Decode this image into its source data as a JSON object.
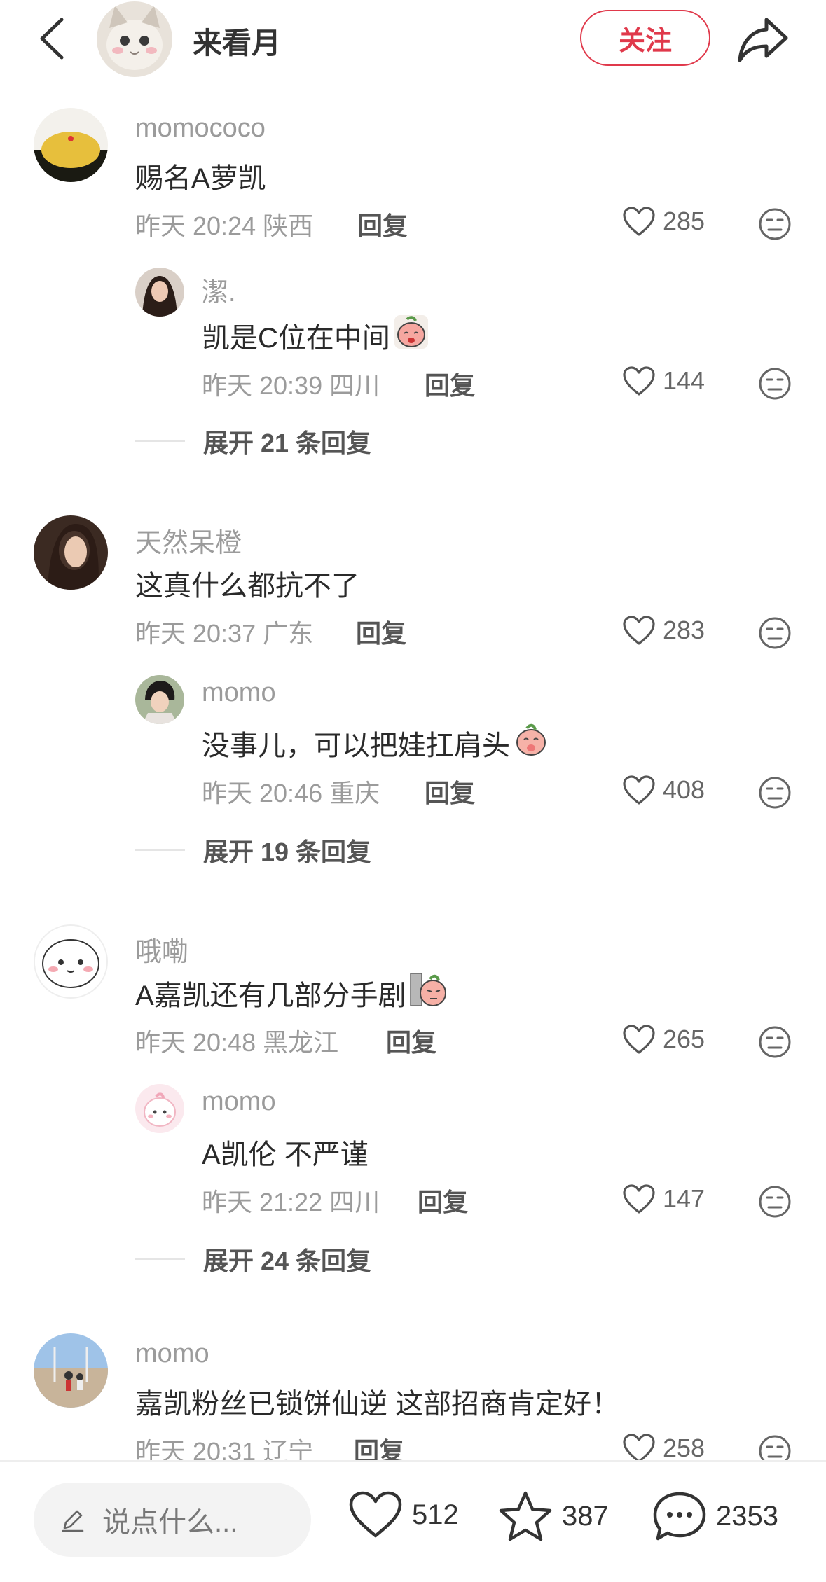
{
  "header": {
    "author_name": "来看月",
    "follow_label": "关注"
  },
  "comments": [
    {
      "user": "momococo",
      "text": "赐名A萝凯",
      "time": "昨天 20:24 陕西",
      "reply_label": "回复",
      "likes": "285",
      "reply": {
        "user": "潔.",
        "text": "凯是C位在中间",
        "time": "昨天 20:39 四川",
        "reply_label": "回复",
        "likes": "144"
      },
      "expand": "展开 21 条回复"
    },
    {
      "user": "天然呆橙",
      "text": "这真什么都抗不了",
      "time": "昨天 20:37 广东",
      "reply_label": "回复",
      "likes": "283",
      "reply": {
        "user": "momo",
        "text": "没事儿，可以把娃扛肩头",
        "time": "昨天 20:46 重庆",
        "reply_label": "回复",
        "likes": "408"
      },
      "expand": "展开 19 条回复"
    },
    {
      "user": "哦嘞",
      "text": "A嘉凯还有几部分手剧",
      "time": "昨天 20:48 黑龙江",
      "reply_label": "回复",
      "likes": "265",
      "reply": {
        "user": "momo",
        "text": "A凯伦 不严谨",
        "time": "昨天 21:22 四川",
        "reply_label": "回复",
        "likes": "147"
      },
      "expand": "展开 24 条回复"
    },
    {
      "user": "momo",
      "text": "嘉凯粉丝已锁饼仙逆 这部招商肯定好！",
      "time": "昨天 20:31 辽宁",
      "reply_label": "回复",
      "likes": "258"
    }
  ],
  "bottom": {
    "placeholder": "说点什么...",
    "likes": "512",
    "favorites": "387",
    "comments": "2353"
  },
  "colors": {
    "accent": "#e0394b",
    "meta_gray": "#9b9b9b"
  }
}
